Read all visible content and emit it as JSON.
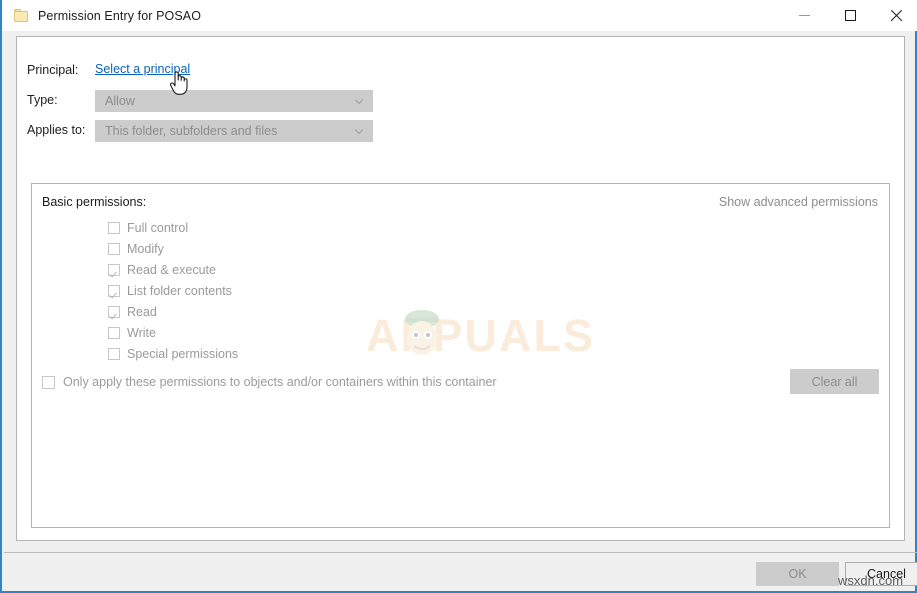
{
  "window": {
    "title": "Permission Entry for POSAO",
    "icon": "folder-icon",
    "accent_color": "#2e86c8",
    "controls": {
      "minimize": "Minimize",
      "maximize": "Maximize",
      "close": "Close"
    }
  },
  "form": {
    "principal": {
      "label": "Principal:",
      "link_text": "Select a principal",
      "link_color": "#0a64b4"
    },
    "type": {
      "label": "Type:",
      "value": "Allow",
      "disabled": true
    },
    "applies_to": {
      "label": "Applies to:",
      "value": "This folder, subfolders and files",
      "disabled": true
    }
  },
  "permissions_group": {
    "title": "Basic permissions:",
    "advanced_link": "Show advanced permissions",
    "items": [
      {
        "label": "Full control",
        "checked": false
      },
      {
        "label": "Modify",
        "checked": false
      },
      {
        "label": "Read & execute",
        "checked": true
      },
      {
        "label": "List folder contents",
        "checked": true
      },
      {
        "label": "Read",
        "checked": true
      },
      {
        "label": "Write",
        "checked": false
      },
      {
        "label": "Special permissions",
        "checked": false
      }
    ],
    "only_apply": {
      "label": "Only apply these permissions to objects and/or containers within this container",
      "checked": false
    },
    "clear_all_label": "Clear all"
  },
  "footer": {
    "ok_label": "OK",
    "cancel_label": "Cancel"
  },
  "watermarks": {
    "center": "APPUALS",
    "bottom_right": "wsxdn.com"
  }
}
